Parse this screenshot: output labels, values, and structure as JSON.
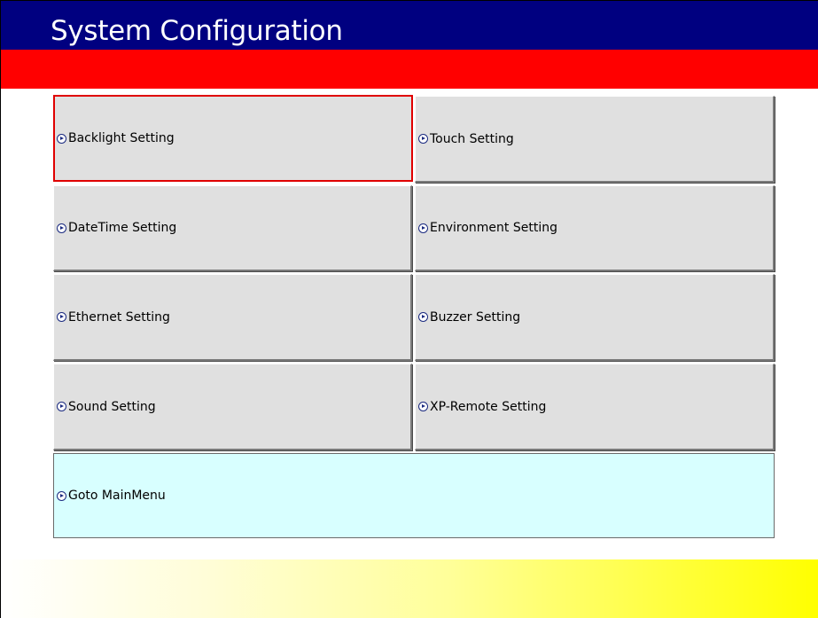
{
  "header": {
    "title": "System Configuration"
  },
  "menu": {
    "buttons": [
      {
        "label": "Backlight Setting",
        "icon": "arrow-circle-icon"
      },
      {
        "label": "Touch Setting",
        "icon": "arrow-circle-icon"
      },
      {
        "label": "DateTime Setting",
        "icon": "arrow-circle-icon"
      },
      {
        "label": "Environment Setting",
        "icon": "arrow-circle-icon"
      },
      {
        "label": "Ethernet Setting",
        "icon": "arrow-circle-icon"
      },
      {
        "label": "Buzzer Setting",
        "icon": "arrow-circle-icon"
      },
      {
        "label": "Sound Setting",
        "icon": "arrow-circle-icon"
      },
      {
        "label": "XP-Remote Setting",
        "icon": "arrow-circle-icon"
      }
    ],
    "main_button": {
      "label": "Goto MainMenu",
      "icon": "arrow-circle-icon"
    },
    "selected_index": 0
  },
  "colors": {
    "title_bar": "#000080",
    "accent_bar": "#ff0000",
    "button_face": "#e0e0e0",
    "main_button_face": "#d8ffff",
    "selection_border": "#e00000",
    "footer_gradient_end": "#ffff00"
  }
}
